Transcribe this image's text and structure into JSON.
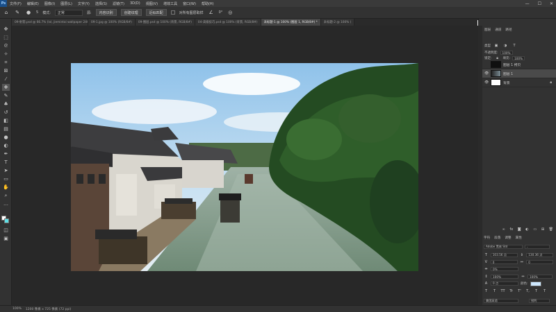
{
  "menubar": {
    "logo": "Ps",
    "items": [
      "文件(F)",
      "编辑(E)",
      "图像(I)",
      "图层(L)",
      "文字(Y)",
      "选择(S)",
      "滤镜(T)",
      "3D(D)",
      "视图(V)",
      "增效工具",
      "窗口(W)",
      "帮助(H)"
    ],
    "minimize": "—",
    "maximize": "☐",
    "close": "✕"
  },
  "options": {
    "brush_size": "5",
    "mode_label": "模式:",
    "mode_value": "正常",
    "source_label": "源:",
    "btn_content_aware": "内容识别",
    "btn_create_texture": "创建纹理",
    "btn_proximity": "近似匹配",
    "sample_all_label": "对所有图层取样",
    "angle_value": "0°"
  },
  "tabs": [
    {
      "label": "09-射箭.psd @ 66.7% (lxl, jiemintai wallpaper 2400x1200, RGB/8#)",
      "active": false
    },
    {
      "label": "09-1.jpg @ 100% (RGB/8#)",
      "active": false
    },
    {
      "label": "09-图层.psd @ 100% (背景, RGB/8#)",
      "active": false
    },
    {
      "label": "04-高级技巧.psd @ 100% (背景, RGB/8#)",
      "active": false
    },
    {
      "label": "未标题-1 @ 100% (图层 1, RGB/8#) *",
      "active": true
    },
    {
      "label": "未标题-2 @ 100% (",
      "active": false
    }
  ],
  "layers": {
    "tabs": [
      "图层",
      "通道",
      "路径"
    ],
    "kind_label": "类型",
    "opacity_label": "不透明度:",
    "opacity_value": "100%",
    "fill_label": "填充:",
    "fill_value": "100%",
    "lock_label": "锁定:",
    "items": [
      {
        "name": "图层 1 拷贝",
        "selected": false
      },
      {
        "name": "图层 1",
        "selected": true
      },
      {
        "name": "背景",
        "selected": false
      }
    ],
    "footer_icons": [
      "link-icon",
      "fx-icon",
      "mask-icon",
      "adjustment-icon",
      "group-icon",
      "new-layer-icon",
      "trash-icon"
    ]
  },
  "character": {
    "tabs": [
      "字符",
      "段落",
      "调整",
      "属性"
    ],
    "font_family": "Adobe 黑体 Std",
    "font_style": "-",
    "font_size": "103.56 点",
    "leading": "130.36 点",
    "kerning": "0",
    "tracking": "0",
    "scale_pct": "0%",
    "vertical_scale": "100%",
    "horizontal_scale": "100%",
    "baseline": "0 点",
    "color_label": "颜色:",
    "color_value": "#cfe9ff",
    "format_buttons": [
      "T",
      "T",
      "TT",
      "Tr",
      "T'",
      "T,",
      "T",
      "T"
    ],
    "language": "美国英语",
    "antialias": "锐利"
  },
  "statusbar": {
    "zoom": "100%",
    "doc_info": "1200 像素 x 725 像素 (72 ppi)"
  }
}
